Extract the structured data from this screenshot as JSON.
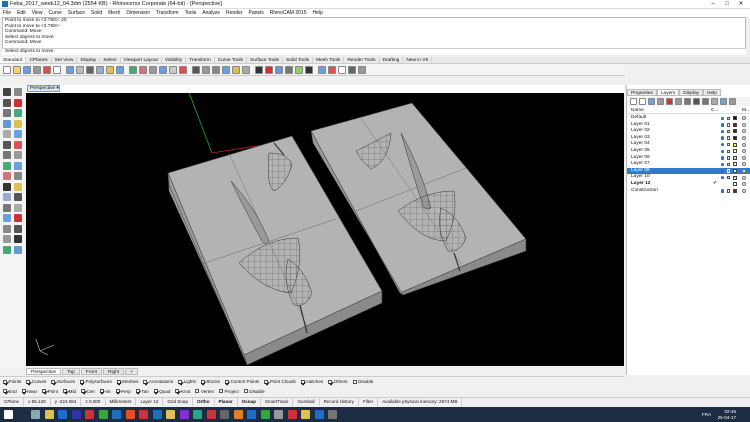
{
  "window": {
    "title": "Feba_2017_week12_04.3dm (2554 KB) - Rhinoceros Corporate (64-bit) - [Perspective]"
  },
  "menu": [
    "File",
    "Edit",
    "View",
    "Curve",
    "Surface",
    "Solid",
    "Mesh",
    "Dimension",
    "Transform",
    "Tools",
    "Analyze",
    "Render",
    "Panels",
    "RhinoCAM 2015",
    "Help"
  ],
  "command_history": [
    "Point to move to <3.760>: 20",
    "Point to move to <3.760>:",
    "Command: Move",
    "Select objects to move:",
    "Command: Move"
  ],
  "command_prompt": "Select objects to move:",
  "toolbar_tabs": [
    "Standard",
    "CPlanes",
    "Set View",
    "Display",
    "Select",
    "Viewport Layout",
    "Visibility",
    "Transform",
    "Curve Tools",
    "Surface Tools",
    "Solid Tools",
    "Mesh Tools",
    "Render Tools",
    "Drafting",
    "New in V5"
  ],
  "active_toolbar_tab": "Standard",
  "viewport": {
    "name": "Perspective"
  },
  "viewport_tabs": [
    "Perspective",
    "Top",
    "Front",
    "Right"
  ],
  "viewport_add": "+",
  "osnap": [
    {
      "label": "Points",
      "checked": true
    },
    {
      "label": "Curves",
      "checked": true
    },
    {
      "label": "Surfaces",
      "checked": true
    },
    {
      "label": "Polysurfaces",
      "checked": true
    },
    {
      "label": "Meshes",
      "checked": true
    },
    {
      "label": "Annotations",
      "checked": true
    },
    {
      "label": "Lights",
      "checked": true
    },
    {
      "label": "Blocks",
      "checked": true
    },
    {
      "label": "Control Points",
      "checked": true
    },
    {
      "label": "Point Clouds",
      "checked": true
    },
    {
      "label": "Hatches",
      "checked": true
    },
    {
      "label": "Others",
      "checked": true
    },
    {
      "label": "Disable",
      "checked": false
    }
  ],
  "snaps": [
    {
      "label": "End",
      "checked": true
    },
    {
      "label": "Near",
      "checked": true
    },
    {
      "label": "Point",
      "checked": true
    },
    {
      "label": "Mid",
      "checked": true
    },
    {
      "label": "Cen",
      "checked": true
    },
    {
      "label": "Int",
      "checked": true
    },
    {
      "label": "Perp",
      "checked": true
    },
    {
      "label": "Tan",
      "checked": true
    },
    {
      "label": "Quad",
      "checked": true
    },
    {
      "label": "Knot",
      "checked": true
    },
    {
      "label": "Vertex",
      "checked": false
    },
    {
      "label": "Project",
      "checked": false
    },
    {
      "label": "Disable",
      "checked": false
    }
  ],
  "status": {
    "cplane": "CPlane",
    "x": "x 85.128",
    "y": "y -224.064",
    "z": "z 0.000",
    "units": "Millimeters",
    "layer": "Layer 12",
    "grid_snap": "Grid Snap",
    "ortho": "Ortho",
    "planar": "Planar",
    "osnap": "Osnap",
    "smarttrack": "SmartTrack",
    "gumball": "Gumball",
    "record_history": "Record History",
    "filter": "Filter",
    "memory": "Available physical memory: 2674 MB"
  },
  "panel": {
    "tabs": [
      "Properties",
      "Layers",
      "Display",
      "Help"
    ],
    "active_tab": "Layers",
    "col_name": "Name",
    "col_c": "C...",
    "col_m": "M...",
    "layers": [
      {
        "name": "Default",
        "color": "#000000",
        "current": false,
        "selected": false
      },
      {
        "name": "Layer 01",
        "color": "#c00000",
        "current": false,
        "selected": false
      },
      {
        "name": "Layer 02",
        "color": "#8b0000",
        "current": false,
        "selected": false
      },
      {
        "name": "Layer 03",
        "color": "#1f1f1f",
        "current": false,
        "selected": false
      },
      {
        "name": "Layer 04",
        "color": "#ffff00",
        "current": false,
        "selected": false
      },
      {
        "name": "Layer 05",
        "color": "#ffffff",
        "current": false,
        "selected": false
      },
      {
        "name": "Layer 06",
        "color": "#e6d0ff",
        "current": false,
        "selected": false
      },
      {
        "name": "Layer 07",
        "color": "#ffffff",
        "current": false,
        "selected": false
      },
      {
        "name": "Layer 08",
        "color": "#ffffff",
        "current": false,
        "selected": true
      },
      {
        "name": "Layer 10",
        "color": "#e0e0ff",
        "current": false,
        "selected": false
      },
      {
        "name": "Layer 12",
        "color": "#ffffff",
        "current": true,
        "selected": false
      },
      {
        "name": "Construction",
        "color": "#c00000",
        "current": false,
        "selected": false
      }
    ]
  },
  "taskbar": {
    "time": "02:46",
    "date": "26-04-17",
    "lang": "FRA"
  },
  "colors": {
    "viewport_bg": "#000000",
    "mold": "#a9a9a9",
    "selection": "#2f7bd0",
    "axis_x": "#c02020",
    "axis_y": "#20b020"
  }
}
